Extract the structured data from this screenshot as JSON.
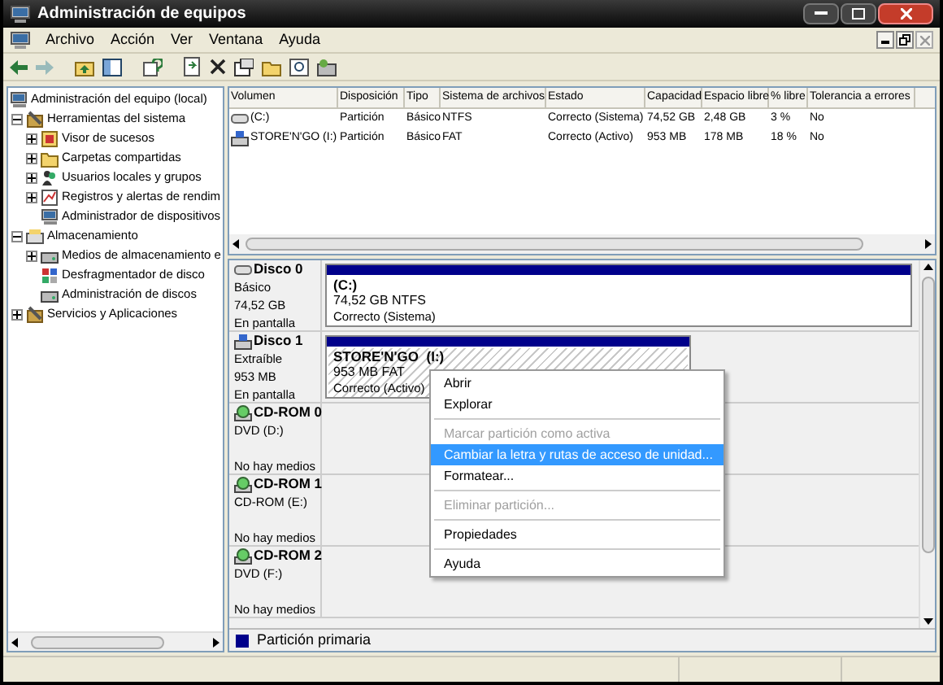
{
  "window": {
    "title": "Administración de equipos"
  },
  "menu": [
    "Archivo",
    "Acción",
    "Ver",
    "Ventana",
    "Ayuda"
  ],
  "tree": [
    {
      "label": "Administración del equipo (local)",
      "children": [
        {
          "label": "Herramientas del sistema",
          "expanded": true,
          "children": [
            {
              "label": "Visor de sucesos",
              "expanded": false
            },
            {
              "label": "Carpetas compartidas",
              "expanded": false
            },
            {
              "label": "Usuarios locales y grupos",
              "expanded": false
            },
            {
              "label": "Registros y alertas de rendim",
              "expanded": false
            },
            {
              "label": "Administrador de dispositivos"
            }
          ]
        },
        {
          "label": "Almacenamiento",
          "expanded": true,
          "children": [
            {
              "label": "Medios de almacenamiento e",
              "expanded": false
            },
            {
              "label": "Desfragmentador de disco"
            },
            {
              "label": "Administración de discos"
            }
          ]
        },
        {
          "label": "Servicios y Aplicaciones",
          "expanded": false
        }
      ]
    }
  ],
  "table": {
    "columns": [
      "Volumen",
      "Disposición",
      "Tipo",
      "Sistema de archivos",
      "Estado",
      "Capacidad",
      "Espacio libre",
      "% libre",
      "Tolerancia a errores"
    ],
    "rows": [
      {
        "kind": "disk",
        "cells": [
          "(C:)",
          "Partición",
          "Básico",
          "NTFS",
          "Correcto (Sistema)",
          "74,52 GB",
          "2,48 GB",
          "3 %",
          "No"
        ]
      },
      {
        "kind": "removable",
        "cells": [
          "STORE'N'GO (I:)",
          "Partición",
          "Básico",
          "FAT",
          "Correcto (Activo)",
          "953 MB",
          "178 MB",
          "18 %",
          "No"
        ]
      }
    ]
  },
  "disks": [
    {
      "kind": "disk",
      "name": "Disco 0",
      "lines": [
        "Básico",
        "74,52 GB",
        "En pantalla"
      ],
      "partition": {
        "label": "(C:)",
        "size": "74,52 GB NTFS",
        "status": "Correcto (Sistema)",
        "selected": false
      }
    },
    {
      "kind": "removable",
      "name": "Disco 1",
      "lines": [
        "Extraíble",
        "953 MB",
        "En pantalla"
      ],
      "partition": {
        "label": "STORE'N'GO  (I:)",
        "size": "953 MB FAT",
        "status": "Correcto (Activo)",
        "selected": true
      }
    },
    {
      "kind": "cdrom",
      "name": "CD-ROM 0",
      "lines": [
        "DVD (D:)",
        "No hay medios"
      ]
    },
    {
      "kind": "cdrom",
      "name": "CD-ROM 1",
      "lines": [
        "CD-ROM (E:)",
        "No hay medios"
      ]
    },
    {
      "kind": "cdrom",
      "name": "CD-ROM 2",
      "lines": [
        "DVD (F:)",
        "No hay medios"
      ]
    }
  ],
  "legend": "Partición primaria",
  "context_menu": [
    {
      "kind": "item",
      "label": "Abrir",
      "disabled": false,
      "selected": false
    },
    {
      "kind": "item",
      "label": "Explorar",
      "disabled": false,
      "selected": false
    },
    {
      "kind": "separator"
    },
    {
      "kind": "item",
      "label": "Marcar partición como activa",
      "disabled": true,
      "selected": false
    },
    {
      "kind": "item",
      "label": "Cambiar la letra y rutas de acceso de unidad...",
      "disabled": false,
      "selected": true
    },
    {
      "kind": "item",
      "label": "Formatear...",
      "disabled": false,
      "selected": false
    },
    {
      "kind": "separator"
    },
    {
      "kind": "item",
      "label": "Eliminar partición...",
      "disabled": true,
      "selected": false
    },
    {
      "kind": "separator"
    },
    {
      "kind": "item",
      "label": "Propiedades",
      "disabled": false,
      "selected": false
    },
    {
      "kind": "separator"
    },
    {
      "kind": "item",
      "label": "Ayuda",
      "disabled": false,
      "selected": false
    }
  ]
}
